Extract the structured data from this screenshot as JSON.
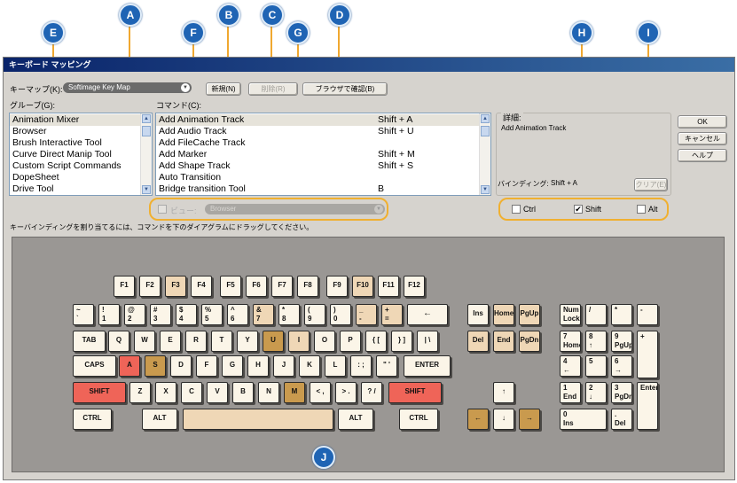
{
  "callouts": [
    "A",
    "B",
    "C",
    "D",
    "E",
    "F",
    "G",
    "H",
    "I",
    "J"
  ],
  "window": {
    "title": "キーボード マッピング",
    "keymap_label": "キーマップ(K):",
    "keymap_value": "Softimage Key Map",
    "new_button": "新規(N)",
    "delete_button": "削除(R)",
    "browse_button": "ブラウザで確認(B)",
    "group_label": "グループ(G):",
    "command_label": "コマンド(C):",
    "detail_label": "詳細:",
    "detail_value": "Add Animation Track",
    "binding_label": "バインディング:",
    "binding_value": "Shift + A",
    "clear_button": "クリア(E)",
    "ok_button": "OK",
    "cancel_button": "キャンセル",
    "help_button": "ヘルプ",
    "view_label": "ビュー:",
    "view_value": "Browser",
    "modifiers": [
      {
        "label": "Ctrl",
        "checked": false
      },
      {
        "label": "Shift",
        "checked": true
      },
      {
        "label": "Alt",
        "checked": false
      }
    ],
    "instruction": "キーバインディングを割り当てるには、コマンドを下のダイアグラムにドラッグしてください。"
  },
  "groups": [
    "Animation Mixer",
    "Browser",
    "Brush Interactive Tool",
    "Curve Direct Manip Tool",
    "Custom Script Commands",
    "DopeSheet",
    "Drive Tool"
  ],
  "commands": [
    {
      "name": "Add Animation Track",
      "shortcut": "Shift + A"
    },
    {
      "name": "Add Audio Track",
      "shortcut": "Shift + U"
    },
    {
      "name": "Add FileCache Track",
      "shortcut": ""
    },
    {
      "name": "Add Marker",
      "shortcut": "Shift + M"
    },
    {
      "name": "Add Shape Track",
      "shortcut": "Shift + S"
    },
    {
      "name": "Auto Transition",
      "shortcut": ""
    },
    {
      "name": "Bridge transition Tool",
      "shortcut": "B"
    }
  ],
  "keyboard": {
    "colors": {
      "assigned_command": "#c99a4e",
      "assigned_other": "#efd7b6",
      "modifier_active": "#ef6458",
      "unassigned": "#fbf5e8"
    },
    "function_row": [
      "F1",
      "F2",
      "F3",
      "F4",
      "F5",
      "F6",
      "F7",
      "F8",
      "F9",
      "F10",
      "F11",
      "F12"
    ],
    "number_row": [
      {
        "top": "~",
        "bottom": "`"
      },
      {
        "top": "!",
        "bottom": "1"
      },
      {
        "top": "@",
        "bottom": "2"
      },
      {
        "top": "#",
        "bottom": "3"
      },
      {
        "top": "$",
        "bottom": "4"
      },
      {
        "top": "%",
        "bottom": "5"
      },
      {
        "top": "^",
        "bottom": "6"
      },
      {
        "top": "&",
        "bottom": "7"
      },
      {
        "top": "*",
        "bottom": "8"
      },
      {
        "top": "(",
        "bottom": "9"
      },
      {
        "top": ")",
        "bottom": "0"
      },
      {
        "top": "_",
        "bottom": "-"
      },
      {
        "top": "+",
        "bottom": "="
      },
      {
        "top": "←",
        "bottom": ""
      }
    ],
    "tab_row": [
      "TAB",
      "Q",
      "W",
      "E",
      "R",
      "T",
      "Y",
      "U",
      "I",
      "O",
      "P",
      "{ [",
      "} ]",
      "| \\"
    ],
    "caps_row": [
      "CAPS",
      "A",
      "S",
      "D",
      "F",
      "G",
      "H",
      "J",
      "K",
      "L",
      ": ;",
      "\" '",
      "ENTER"
    ],
    "shift_row": [
      "SHIFT",
      "Z",
      "X",
      "C",
      "V",
      "B",
      "N",
      "M",
      "< ,",
      "> .",
      "? /",
      "SHIFT"
    ],
    "bottom_row": [
      "CTRL",
      "ALT",
      "",
      "ALT",
      "CTRL"
    ],
    "nav": [
      "Ins",
      "Home",
      "PgUp",
      "Del",
      "End",
      "PgDn"
    ],
    "arrows": [
      "↑",
      "←",
      "↓",
      "→"
    ],
    "numpad": [
      {
        "top": "Num",
        "bottom": "Lock"
      },
      {
        "top": "/",
        "bottom": ""
      },
      {
        "top": "*",
        "bottom": ""
      },
      {
        "top": "-",
        "bottom": ""
      },
      {
        "top": "7",
        "bottom": "Home"
      },
      {
        "top": "8",
        "bottom": "↑"
      },
      {
        "top": "9",
        "bottom": "PgUp"
      },
      {
        "top": "+",
        "bottom": ""
      },
      {
        "top": "4",
        "bottom": "←"
      },
      {
        "top": "5",
        "bottom": ""
      },
      {
        "top": "6",
        "bottom": "→"
      },
      {
        "top": "1",
        "bottom": "End"
      },
      {
        "top": "2",
        "bottom": "↓"
      },
      {
        "top": "3",
        "bottom": "PgDn"
      },
      {
        "top": "Enter",
        "bottom": ""
      },
      {
        "top": "0",
        "bottom": "Ins"
      },
      {
        "top": ".",
        "bottom": "Del"
      }
    ]
  }
}
